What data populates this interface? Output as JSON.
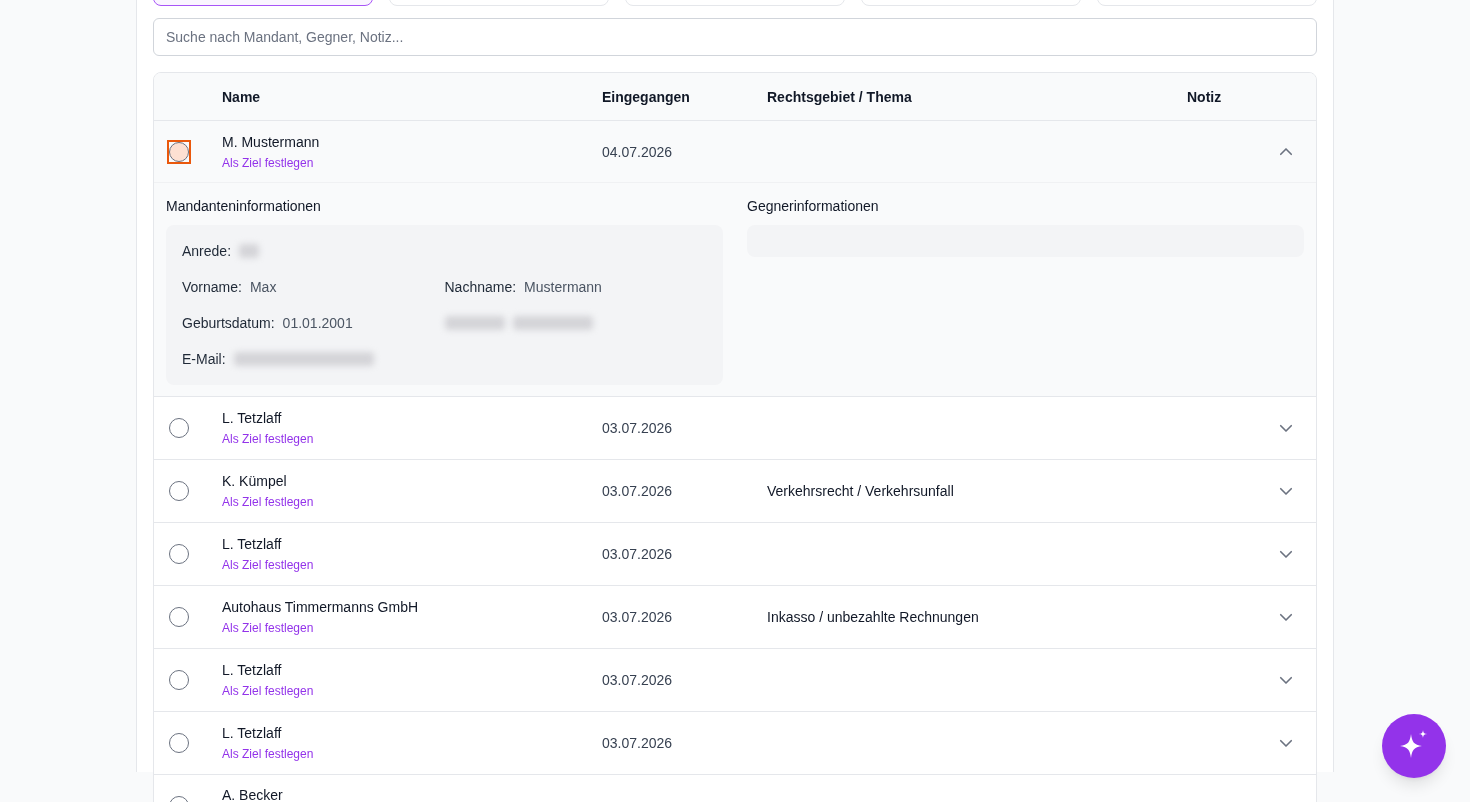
{
  "tabs": [
    {
      "selected": true
    },
    {
      "selected": false
    },
    {
      "selected": false
    },
    {
      "selected": false
    },
    {
      "selected": false
    }
  ],
  "search": {
    "placeholder": "Suche nach Mandant, Gegner, Notiz..."
  },
  "table": {
    "columns": [
      "Name",
      "Eingegangen",
      "Rechtsgebiet / Thema",
      "Notiz"
    ],
    "rows": [
      {
        "name": "M. Mustermann",
        "action": "Als Ziel festlegen",
        "date": "04.07.2026",
        "topic": "",
        "focused": true,
        "expanded": true,
        "details": {
          "client_title": "Mandanteninformationen",
          "opponent_title": "Gegnerinformationen",
          "fields": [
            {
              "label": "Anrede:",
              "value_blurred": true
            },
            {
              "label": "Vorname:",
              "value": "Max"
            },
            {
              "label": "Nachname:",
              "value": "Mustermann"
            },
            {
              "label": "Geburtsdatum:",
              "value": "01.01.2001"
            },
            {
              "label_blurred": true,
              "value_blurred": true
            },
            {
              "label": "E-Mail:",
              "value_blurred": true
            }
          ]
        }
      },
      {
        "name": "L. Tetzlaff",
        "action": "Als Ziel festlegen",
        "date": "03.07.2026",
        "topic": "",
        "focused": false,
        "expanded": false
      },
      {
        "name": "K. Kümpel",
        "action": "Als Ziel festlegen",
        "date": "03.07.2026",
        "topic": "Verkehrsrecht / Verkehrsunfall",
        "focused": false,
        "expanded": false
      },
      {
        "name": "L. Tetzlaff",
        "action": "Als Ziel festlegen",
        "date": "03.07.2026",
        "topic": "",
        "focused": false,
        "expanded": false
      },
      {
        "name": "Autohaus Timmermanns GmbH",
        "action": "Als Ziel festlegen",
        "date": "03.07.2026",
        "topic": "Inkasso / unbezahlte Rechnungen",
        "focused": false,
        "expanded": false
      },
      {
        "name": "L. Tetzlaff",
        "action": "Als Ziel festlegen",
        "date": "03.07.2026",
        "topic": "",
        "focused": false,
        "expanded": false
      },
      {
        "name": "L. Tetzlaff",
        "action": "Als Ziel festlegen",
        "date": "03.07.2026",
        "topic": "",
        "focused": false,
        "expanded": false
      },
      {
        "name": "A. Becker",
        "focused": false
      }
    ]
  }
}
